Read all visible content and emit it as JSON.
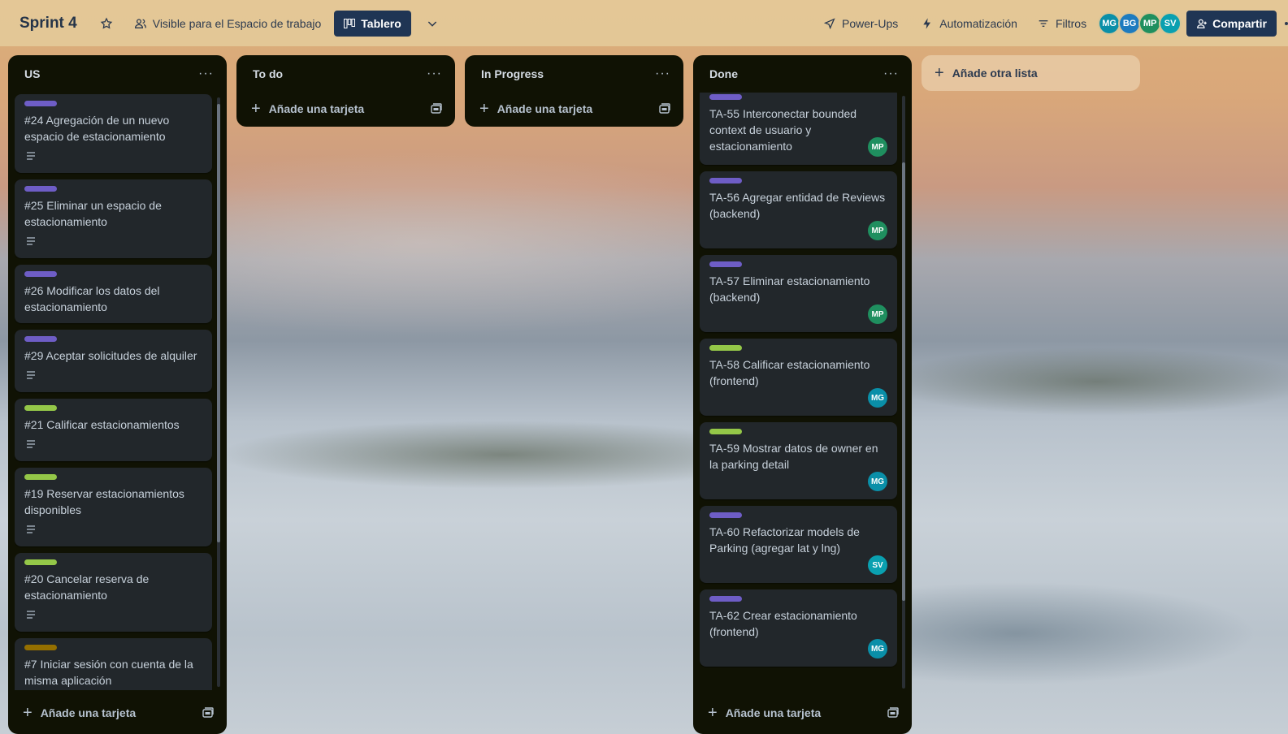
{
  "header": {
    "board_title": "Sprint 4",
    "visibility_label": "Visible para el Espacio de trabajo",
    "view_label": "Tablero",
    "powerups_label": "Power-Ups",
    "automation_label": "Automatización",
    "filters_label": "Filtros",
    "members": [
      {
        "initials": "MG",
        "color": "#0a8fa8"
      },
      {
        "initials": "BG",
        "color": "#1d7bbf"
      },
      {
        "initials": "MP",
        "color": "#1f8f5f"
      },
      {
        "initials": "SV",
        "color": "#0aa0b0"
      }
    ],
    "share_label": "Compartir"
  },
  "lists": {
    "us": {
      "title": "US",
      "cards": [
        {
          "title": "#24 Agregación de un nuevo espacio de estacionamiento",
          "label_color": "#6e5dc6",
          "has_description": true
        },
        {
          "title": "#25 Eliminar un espacio de estacionamiento",
          "label_color": "#6e5dc6",
          "has_description": true
        },
        {
          "title": "#26 Modificar los datos del estacionamiento",
          "label_color": "#6e5dc6",
          "has_description": false
        },
        {
          "title": "#29 Aceptar solicitudes de alquiler",
          "label_color": "#6e5dc6",
          "has_description": true
        },
        {
          "title": "#21 Calificar estacionamientos",
          "label_color": "#94c748",
          "has_description": true
        },
        {
          "title": "#19 Reservar estacionamientos disponibles",
          "label_color": "#94c748",
          "has_description": true
        },
        {
          "title": "#20 Cancelar reserva de estacionamiento",
          "label_color": "#94c748",
          "has_description": true
        },
        {
          "title": "#7 Iniciar sesión con cuenta de la misma aplicación",
          "label_color": "#946f00",
          "has_description": true
        }
      ],
      "add_card_label": "Añade una tarjeta"
    },
    "todo": {
      "title": "To do",
      "add_card_label": "Añade una tarjeta"
    },
    "inprogress": {
      "title": "In Progress",
      "add_card_label": "Añade una tarjeta"
    },
    "done": {
      "title": "Done",
      "cards": [
        {
          "title": "TA-55 Interconectar bounded context de usuario y estacionamiento",
          "label_color": "#6e5dc6",
          "member": "MP",
          "member_color": "#1f8f5f"
        },
        {
          "title": "TA-56 Agregar entidad de Reviews (backend)",
          "label_color": "#6e5dc6",
          "member": "MP",
          "member_color": "#1f8f5f"
        },
        {
          "title": "TA-57 Eliminar estacionamiento (backend)",
          "label_color": "#6e5dc6",
          "member": "MP",
          "member_color": "#1f8f5f"
        },
        {
          "title": "TA-58 Calificar estacionamiento (frontend)",
          "label_color": "#94c748",
          "member": "MG",
          "member_color": "#0a8fa8"
        },
        {
          "title": "TA-59 Mostrar datos de owner en la parking detail",
          "label_color": "#94c748",
          "member": "MG",
          "member_color": "#0a8fa8"
        },
        {
          "title": "TA-60 Refactorizar models de Parking (agregar lat y lng)",
          "label_color": "#6e5dc6",
          "member": "SV",
          "member_color": "#0aa0b0"
        },
        {
          "title": "TA-62 Crear estacionamiento (frontend)",
          "label_color": "#6e5dc6",
          "member": "MG",
          "member_color": "#0a8fa8"
        }
      ],
      "add_card_label": "Añade una tarjeta"
    }
  },
  "add_list_label": "Añade otra lista",
  "icons": {
    "star": "star-icon",
    "visibility": "people-icon",
    "board_view": "board-icon",
    "powerups": "rocket-icon",
    "automation": "lightning-icon",
    "filters": "filter-icon",
    "share": "add-person-icon",
    "description": "description-icon",
    "template": "template-icon"
  }
}
